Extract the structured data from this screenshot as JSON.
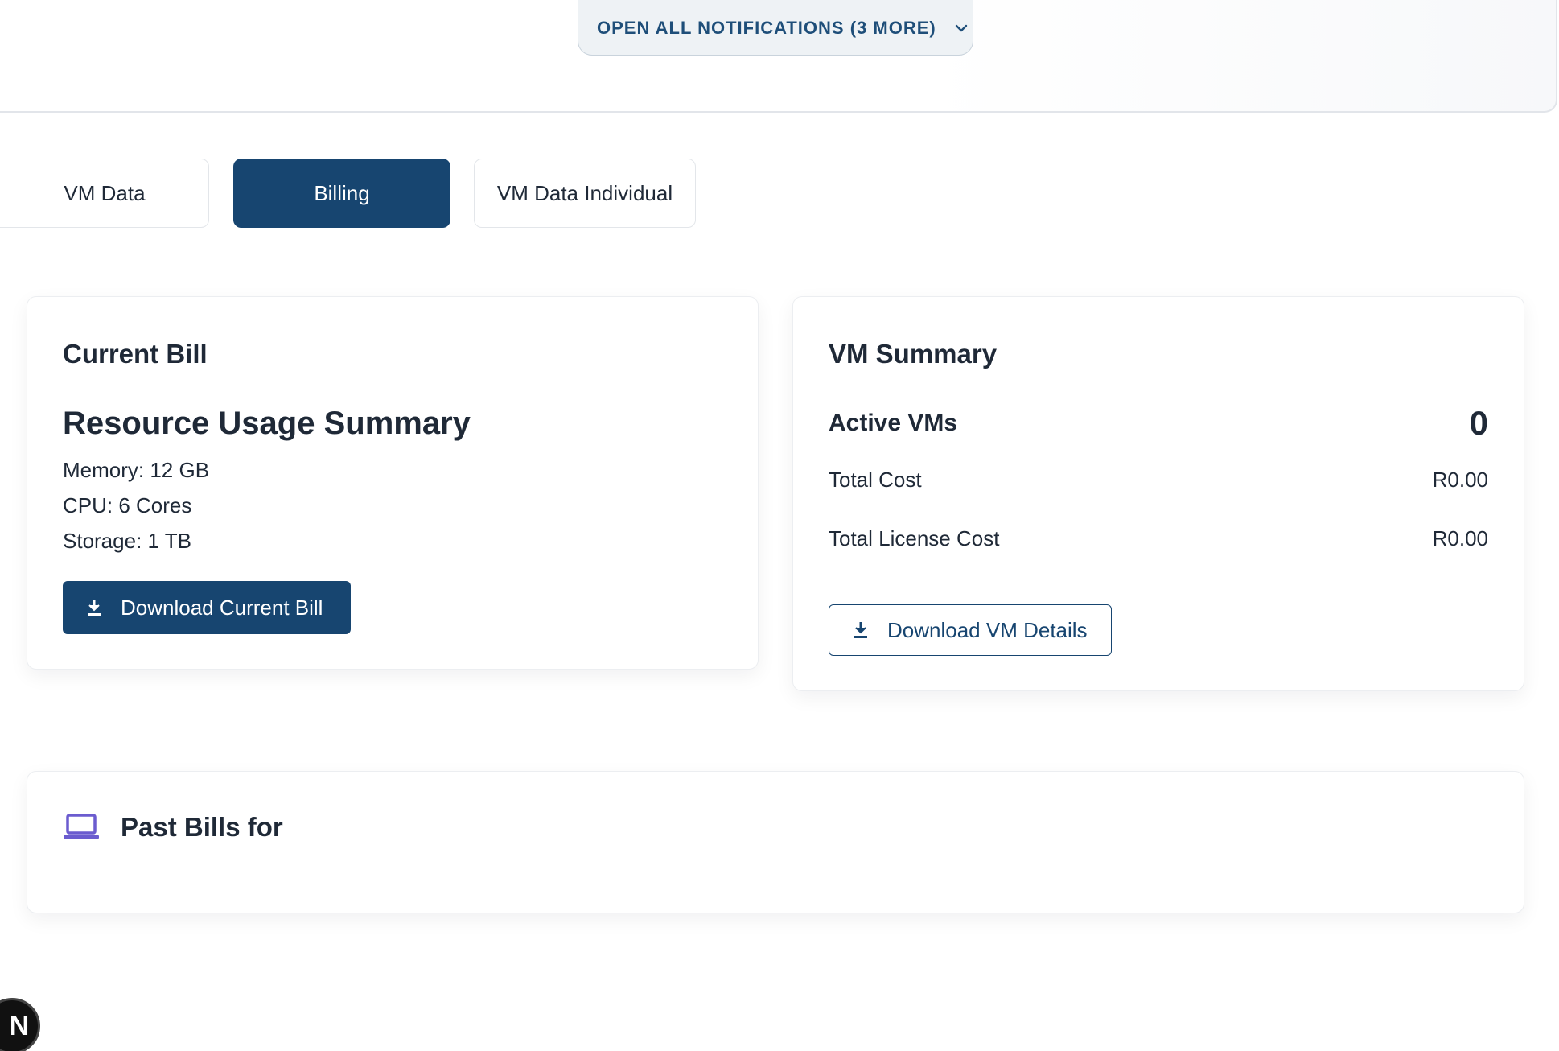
{
  "notifications": {
    "open_all_label": "OPEN ALL NOTIFICATIONS (3 MORE)",
    "chevron_icon": "chevron-down-icon"
  },
  "tabs": [
    {
      "label": "VM Data",
      "active": false
    },
    {
      "label": "Billing",
      "active": true
    },
    {
      "label": "VM Data Individual",
      "active": false
    }
  ],
  "current_bill": {
    "title": "Current Bill",
    "usage_title": "Resource Usage Summary",
    "memory": "Memory: 12 GB",
    "cpu": "CPU: 6 Cores",
    "storage": "Storage: 1 TB",
    "download_label": "Download Current Bill",
    "download_icon": "download-icon"
  },
  "vm_summary": {
    "title": "VM Summary",
    "active_vms_label": "Active VMs",
    "active_vms_value": "0",
    "total_cost_label": "Total Cost",
    "total_cost_value": "R0.00",
    "total_license_cost_label": "Total License Cost",
    "total_license_cost_value": "R0.00",
    "download_label": "Download VM Details",
    "download_icon": "download-icon"
  },
  "past_bills": {
    "title": "Past Bills for",
    "icon": "laptop-icon",
    "icon_color": "#6b5ccf"
  },
  "badge": {
    "letter": "N"
  },
  "colors": {
    "primary": "#174570",
    "notif_text": "#1e4e79"
  }
}
